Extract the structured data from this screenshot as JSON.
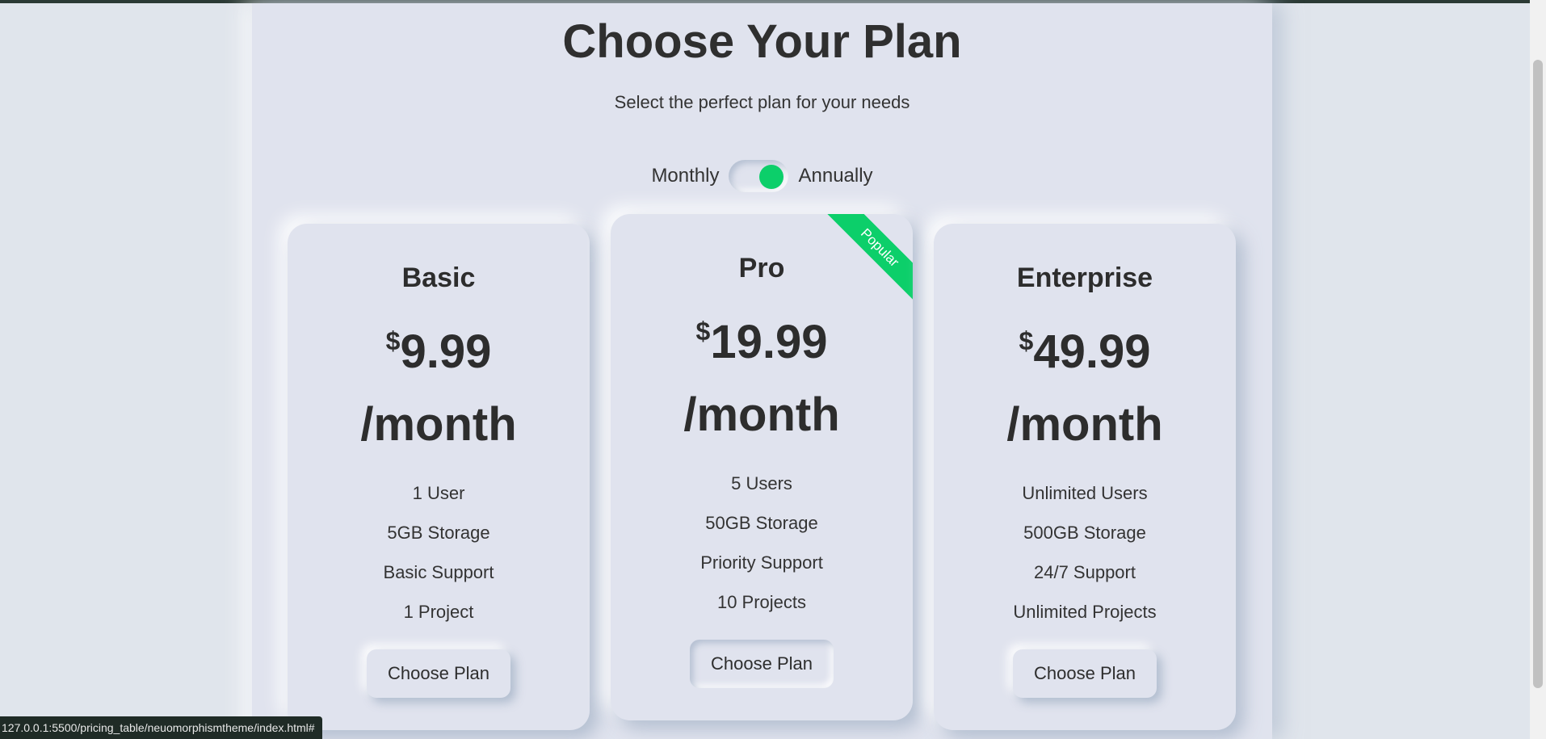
{
  "header": {
    "title": "Choose Your Plan",
    "subtitle": "Select the perfect plan for your needs"
  },
  "billing_toggle": {
    "left_label": "Monthly",
    "right_label": "Annually",
    "state": "annually"
  },
  "plans": [
    {
      "name": "Basic",
      "currency": "$",
      "price": "9.99",
      "period": "/month",
      "features": [
        "1 User",
        "5GB Storage",
        "Basic Support",
        "1 Project"
      ],
      "button_label": "Choose Plan"
    },
    {
      "name": "Pro",
      "currency": "$",
      "price": "19.99",
      "period": "/month",
      "badge": "Popular",
      "features": [
        "5 Users",
        "50GB Storage",
        "Priority Support",
        "10 Projects"
      ],
      "button_label": "Choose Plan"
    },
    {
      "name": "Enterprise",
      "currency": "$",
      "price": "49.99",
      "period": "/month",
      "features": [
        "Unlimited Users",
        "500GB Storage",
        "24/7 Support",
        "Unlimited Projects"
      ],
      "button_label": "Choose Plan"
    }
  ],
  "status_bar": {
    "url": "127.0.0.1:5500/pricing_table/neuomorphismtheme/index.html#"
  },
  "colors": {
    "background": "#e0e5ec",
    "accent": "#0ccf6a",
    "text": "#2d2d2d"
  }
}
